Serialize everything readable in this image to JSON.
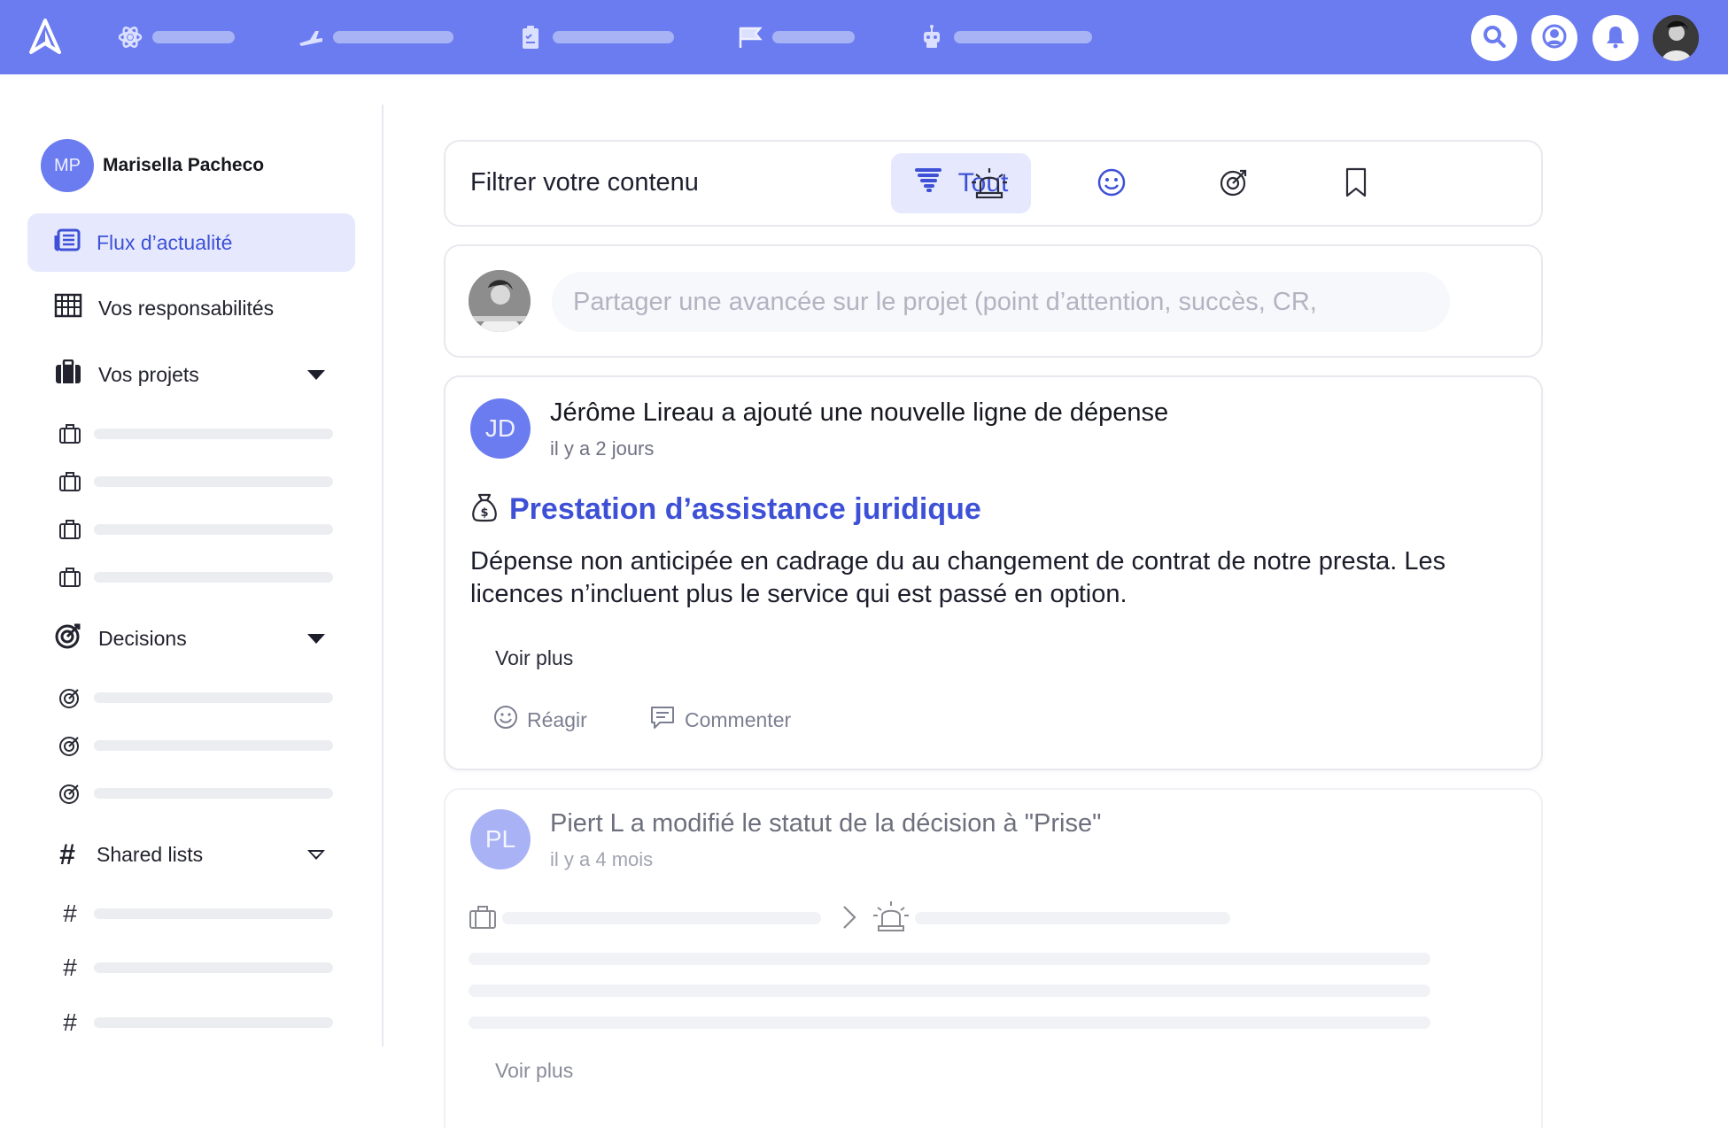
{
  "colors": {
    "primary": "#6b7cf0",
    "accent_text": "#3e51d6",
    "active_bg": "#e6e9fd"
  },
  "topnav": {
    "logo_icon": "app-logo-icon",
    "items": [
      {
        "icon": "atom-icon"
      },
      {
        "icon": "plane-icon"
      },
      {
        "icon": "clipboard-icon"
      },
      {
        "icon": "flag-icon"
      },
      {
        "icon": "robot-icon"
      }
    ],
    "right_buttons": [
      "search-icon",
      "user-icon",
      "bell-icon",
      "profile-photo"
    ]
  },
  "sidebar": {
    "user": {
      "initials": "MP",
      "name": "Marisella Pacheco"
    },
    "items": [
      {
        "label": "Flux d’actualité",
        "icon": "newspaper-icon",
        "active": true
      },
      {
        "label": "Vos responsabilités",
        "icon": "grid-icon",
        "active": false
      },
      {
        "label": "Vos projets",
        "icon": "briefcase-icon",
        "active": false
      },
      {
        "label": "Decisions",
        "icon": "target-icon",
        "active": false
      },
      {
        "label": "Shared lists",
        "icon": "hash-icon",
        "active": false
      }
    ],
    "hash_symbol": "#"
  },
  "filter": {
    "title": "Filtrer votre contenu",
    "active_tab": "Tout",
    "tabs": [
      "tornado-icon",
      "alarm-icon",
      "smile-icon",
      "target-icon",
      "bookmark-icon"
    ]
  },
  "share": {
    "placeholder": "Partager une avancée sur le projet (point d’attention, succès, CR,"
  },
  "posts": [
    {
      "initials": "JD",
      "headline": "Jérôme Lireau a ajouté une nouvelle ligne de dépense",
      "time": "il y a 2 jours",
      "title": "Prestation d’assistance juridique",
      "title_icon": "money-bag-icon",
      "body": "Dépense non anticipée en cadrage du au changement de contrat de notre presta. Les licences n’incluent plus le service qui est passé en option.",
      "more": "Voir plus",
      "react": "Réagir",
      "comment": "Commenter"
    },
    {
      "initials": "PL",
      "headline": "Piert L a modifié le statut de la décision à \"Prise\"",
      "time": "il y a 4 mois",
      "more": "Voir plus"
    }
  ]
}
